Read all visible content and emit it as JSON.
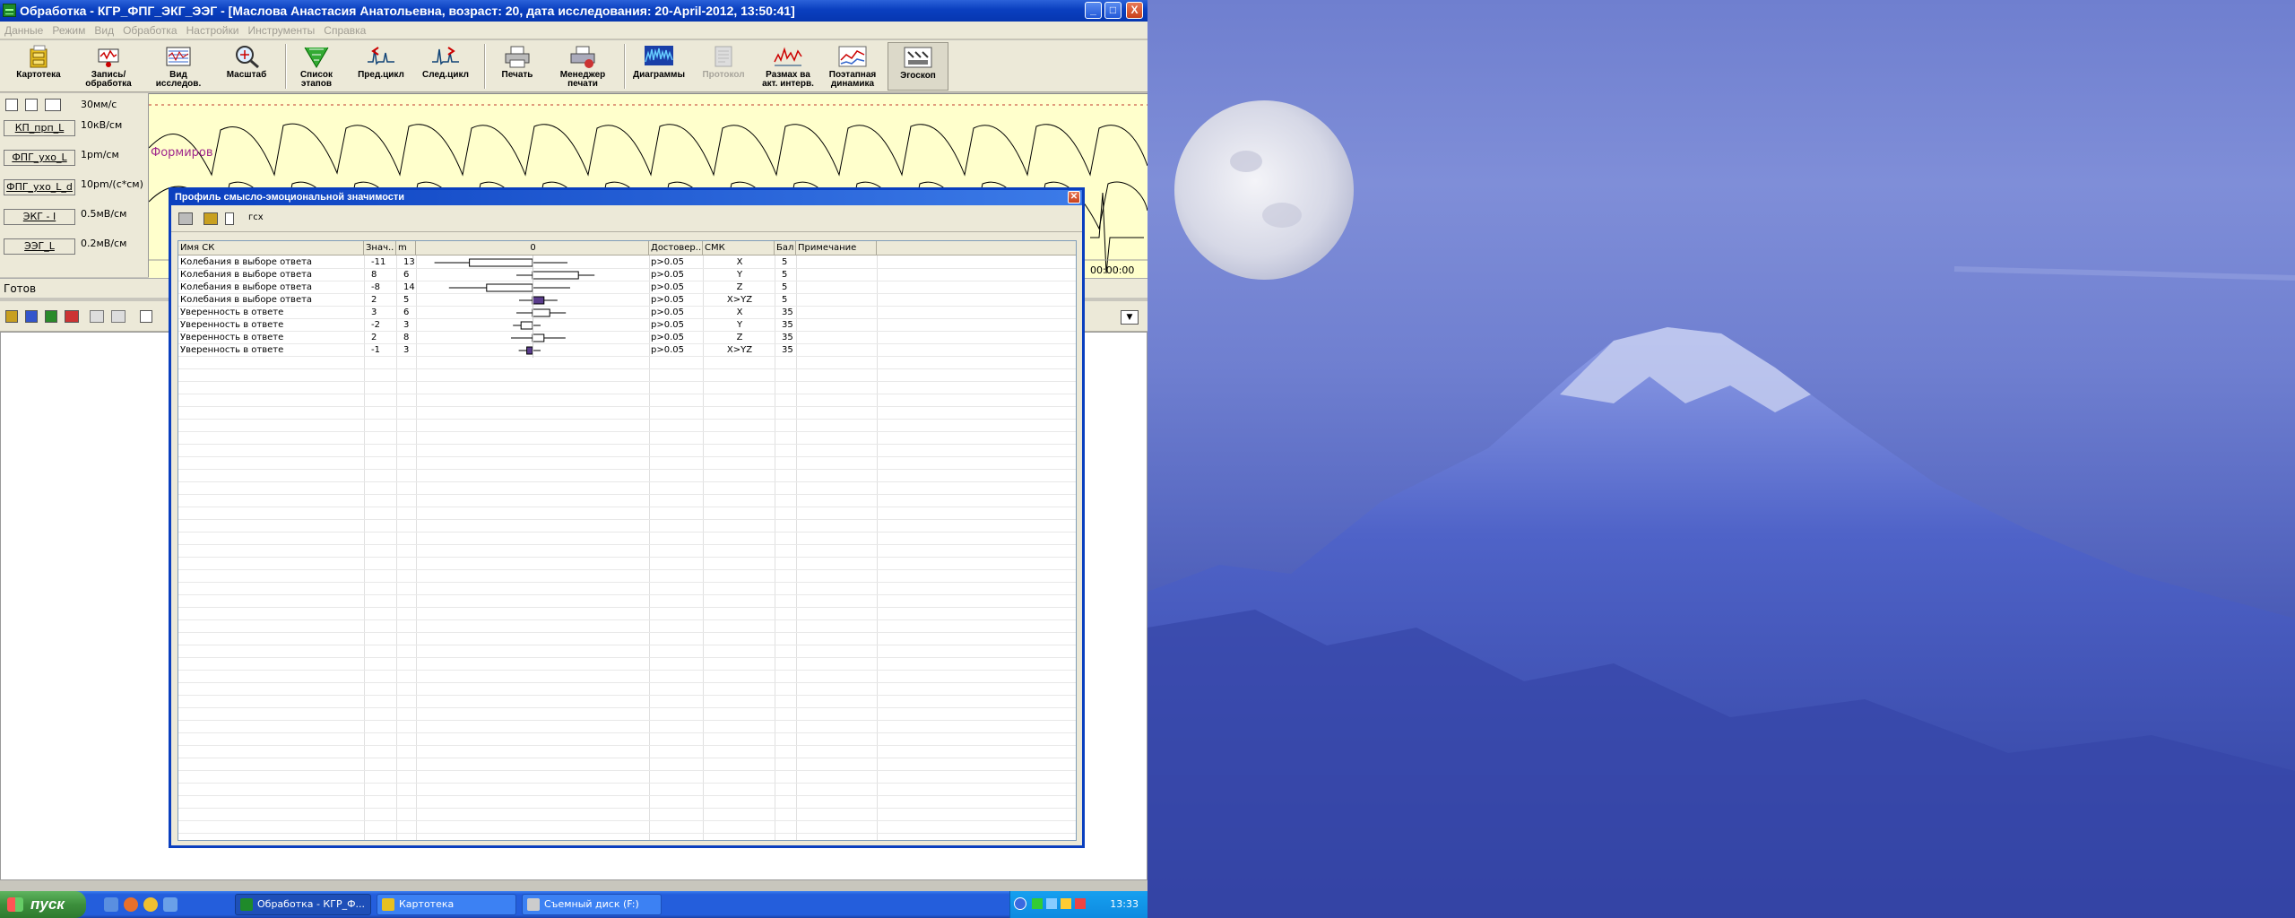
{
  "app": {
    "title": "Обработка - КГР_ФПГ_ЭКГ_ЭЭГ - [Маслова Анастасия Анатольевна, возраст: 20, дата исследования: 20-April-2012, 13:50:41]",
    "window_controls": {
      "minimize": "_",
      "maximize": "□",
      "close": "X"
    }
  },
  "menu": [
    "Данные",
    "Режим",
    "Вид",
    "Обработка",
    "Настройки",
    "Инструменты",
    "Справка"
  ],
  "toolbar": [
    {
      "label": "Картотека",
      "icon": "file-cabinet-icon",
      "disabled": false
    },
    {
      "label": "Запись/ обработка",
      "icon": "record-process-icon",
      "disabled": false
    },
    {
      "label": "Вид исследов.",
      "icon": "research-view-icon",
      "disabled": false
    },
    {
      "label": "Масштаб",
      "icon": "zoom-icon",
      "disabled": false
    },
    {
      "label": "Список этапов",
      "icon": "stages-list-icon",
      "disabled": false
    },
    {
      "label": "Пред.цикл",
      "icon": "prev-cycle-icon",
      "disabled": false
    },
    {
      "label": "След.цикл",
      "icon": "next-cycle-icon",
      "disabled": false
    },
    {
      "label": "Печать",
      "icon": "printer-icon",
      "disabled": false
    },
    {
      "label": "Менеджер печати",
      "icon": "print-manager-icon",
      "disabled": false
    },
    {
      "label": "Диаграммы",
      "icon": "diagrams-icon",
      "disabled": false
    },
    {
      "label": "Протокол",
      "icon": "protocol-icon",
      "disabled": true
    },
    {
      "label": "Размах ва акт. интерв.",
      "icon": "range-interval-icon",
      "disabled": false
    },
    {
      "label": "Поэтапная динамика",
      "icon": "stage-dynamics-icon",
      "disabled": false
    },
    {
      "label": "Эгоскоп",
      "icon": "egoscope-icon",
      "disabled": false
    }
  ],
  "channels": {
    "speed": "30мм/с",
    "items": [
      {
        "label": "КП_прп_L",
        "scale": "10кВ/см"
      },
      {
        "label": "ФПГ_ухо_L",
        "scale": "1pm/см"
      },
      {
        "label": "ФПГ_ухо_L_d",
        "scale": "10pm/(с*см)"
      },
      {
        "label": "ЭКГ - I",
        "scale": "0.5мВ/см"
      },
      {
        "label": "ЭЭГ_L",
        "scale": "0.2мВ/см"
      }
    ],
    "annotation": "Формиров",
    "time_readout": "00:00:00"
  },
  "status": {
    "text": "Готов"
  },
  "dialog": {
    "title": "Профиль смысло-эмоциональной значимости",
    "toolbar_label": "гсх",
    "columns": [
      "Имя СК",
      "Знач..",
      "m",
      "0",
      "Достовер..",
      "СМК",
      "Бал",
      "Примечание"
    ],
    "chart_data": {
      "type": "boxplot",
      "axis_zero_label": "0",
      "rows": [
        {
          "name": "Колебания в выборе ответа",
          "value": -11,
          "m": 13,
          "p": "p>0.05",
          "smk": "X",
          "score": 5
        },
        {
          "name": "Колебания в выборе ответа",
          "value": 8,
          "m": 6,
          "p": "p>0.05",
          "smk": "Y",
          "score": 5
        },
        {
          "name": "Колебания в выборе ответа",
          "value": -8,
          "m": 14,
          "p": "p>0.05",
          "smk": "Z",
          "score": 5
        },
        {
          "name": "Колебания в выборе ответа",
          "value": 2,
          "m": 5,
          "p": "p>0.05",
          "smk": "X>YZ",
          "score": 5
        },
        {
          "name": "Уверенность в ответе",
          "value": 3,
          "m": 6,
          "p": "p>0.05",
          "smk": "X",
          "score": 35
        },
        {
          "name": "Уверенность в ответе",
          "value": -2,
          "m": 3,
          "p": "p>0.05",
          "smk": "Y",
          "score": 35
        },
        {
          "name": "Уверенность в ответе",
          "value": 2,
          "m": 8,
          "p": "p>0.05",
          "smk": "Z",
          "score": 35
        },
        {
          "name": "Уверенность в ответе",
          "value": -1,
          "m": 3,
          "p": "p>0.05",
          "smk": "X>YZ",
          "score": 35
        }
      ]
    }
  },
  "taskbar": {
    "start": "пуск",
    "tasks": [
      {
        "label": "Обработка - КГР_Ф...",
        "active": true
      },
      {
        "label": "Картотека",
        "active": false
      },
      {
        "label": "Съемный диск (F:)",
        "active": false
      }
    ],
    "clock": "13:33"
  },
  "colors": {
    "title_bar": "#0a3fbf",
    "chart_bg": "#ffffcc",
    "wave": "#000000",
    "annotation": "#a0288c",
    "desktop_sky": "#7f8ed8"
  }
}
